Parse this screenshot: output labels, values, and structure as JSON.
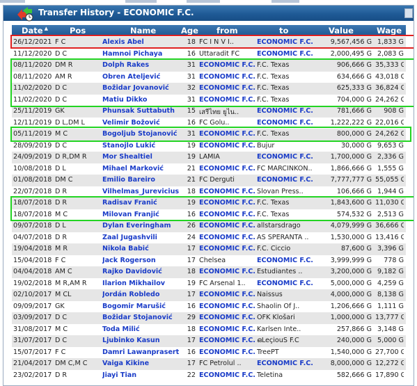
{
  "window": {
    "title": "Transfer History - ECONOMIC F.C."
  },
  "columns": {
    "date": "Date",
    "pos": "Pos",
    "name": "Name",
    "age": "Age",
    "from": "from",
    "to": "to",
    "value": "Value",
    "wage": "Wage"
  },
  "sort_indicator": "▲",
  "colors": {
    "titlebar": "#1f5a96",
    "link": "#1a3cc8",
    "highlight_red": "#e02020",
    "highlight_green": "#22d422"
  },
  "rows": [
    {
      "date": "26/12/2021",
      "pos": "F C",
      "name": "Alexis Abel",
      "age": "18",
      "from": "FC   I N V I..",
      "to": "ECONOMIC F.C.",
      "value": "9,567,456 G",
      "wage": "1,833 G"
    },
    {
      "date": "11/12/2020",
      "pos": "D C",
      "name": "Hamnoi Pichaya",
      "age": "16",
      "from": "Uttaradit FC",
      "to": "ECONOMIC F.C.",
      "value": "2,000,495 G",
      "wage": "2,083 G"
    },
    {
      "date": "08/11/2020",
      "pos": "DM R",
      "name": "Dolph Rakes",
      "age": "31",
      "from": "ECONOMIC F.C.",
      "to": "F.C. Texas",
      "value": "906,666 G",
      "wage": "35,333 G"
    },
    {
      "date": "08/11/2020",
      "pos": "AM R",
      "name": "Obren Ateljević",
      "age": "31",
      "from": "ECONOMIC F.C.",
      "to": "F.C. Texas",
      "value": "634,666 G",
      "wage": "43,018 G"
    },
    {
      "date": "11/02/2020",
      "pos": "D C",
      "name": "Božidar Jovanović",
      "age": "32",
      "from": "ECONOMIC F.C.",
      "to": "F.C. Texas",
      "value": "625,333 G",
      "wage": "36,824 G"
    },
    {
      "date": "11/02/2020",
      "pos": "D C",
      "name": "Matiu Dikko",
      "age": "31",
      "from": "ECONOMIC F.C.",
      "to": "F.C. Texas",
      "value": "704,000 G",
      "wage": "24,262 G"
    },
    {
      "date": "25/11/2019",
      "pos": "GK",
      "name": "Phunsak Suttabuth",
      "age": "15",
      "from": "เสรีไทย ยูไน..",
      "to": "ECONOMIC F.C.",
      "value": "781,666 G",
      "wage": "908 G"
    },
    {
      "date": "12/11/2019",
      "pos": "D L,DM L",
      "name": "Velimir Božović",
      "age": "16",
      "from": "FC Golu..",
      "to": "ECONOMIC F.C.",
      "value": "1,222,222 G",
      "wage": "22,016 G"
    },
    {
      "date": "05/11/2019",
      "pos": "M C",
      "name": "Bogoljub Stojanović",
      "age": "31",
      "from": "ECONOMIC F.C.",
      "to": "F.C. Texas",
      "value": "800,000 G",
      "wage": "24,262 G"
    },
    {
      "date": "28/09/2019",
      "pos": "D C",
      "name": "Stanojlo Lukić",
      "age": "19",
      "from": "ECONOMIC F.C.",
      "to": "Bujur",
      "value": "30,000 G",
      "wage": "9,653 G"
    },
    {
      "date": "24/09/2019",
      "pos": "D R,DM R",
      "name": "Mor Shealtiel",
      "age": "19",
      "from": "LAMIA",
      "to": "ECONOMIC F.C.",
      "value": "1,700,000 G",
      "wage": "2,336 G"
    },
    {
      "date": "10/08/2018",
      "pos": "D L",
      "name": "Mihael Marković",
      "age": "21",
      "from": "ECONOMIC F.C.",
      "to": "FC MARCINKON..",
      "value": "1,866,666 G",
      "wage": "1,555 G"
    },
    {
      "date": "01/08/2018",
      "pos": "DM C",
      "name": "Emilio Bareiro",
      "age": "21",
      "from": "FC Derguti",
      "to": "ECONOMIC F.C.",
      "value": "7,777,777 G",
      "wage": "55,055 G"
    },
    {
      "date": "22/07/2018",
      "pos": "D R",
      "name": "Vilhelmas_Jurevicius",
      "age": "18",
      "from": "ECONOMIC F.C.",
      "to": "Slovan Press..",
      "value": "106,666 G",
      "wage": "1,944 G"
    },
    {
      "date": "18/07/2018",
      "pos": "D R",
      "name": "Radisav Franić",
      "age": "19",
      "from": "ECONOMIC F.C.",
      "to": "F.C. Texas",
      "value": "1,843,600 G",
      "wage": "11,030 G"
    },
    {
      "date": "18/07/2018",
      "pos": "M C",
      "name": "Milovan Franjić",
      "age": "16",
      "from": "ECONOMIC F.C.",
      "to": "F.C. Texas",
      "value": "574,532 G",
      "wage": "2,513 G"
    },
    {
      "date": "09/07/2018",
      "pos": "D L",
      "name": "Dylan Everingham",
      "age": "26",
      "from": "ECONOMIC F.C.",
      "to": "allstarsdrago",
      "value": "4,079,999 G",
      "wage": "36,666 G"
    },
    {
      "date": "04/07/2018",
      "pos": "D R",
      "name": "Zaal Jugashvili",
      "age": "24",
      "from": "ECONOMIC F.C.",
      "to": "AS SPERANTA ..",
      "value": "1,530,000 G",
      "wage": "13,416 G"
    },
    {
      "date": "19/04/2018",
      "pos": "M R",
      "name": "Nikola Babić",
      "age": "17",
      "from": "ECONOMIC F.C.",
      "to": "F.C. Ciccio",
      "value": "87,600 G",
      "wage": "3,396 G"
    },
    {
      "date": "15/04/2018",
      "pos": "F C",
      "name": "Jack Rogerson",
      "age": "17",
      "from": "Chelsea",
      "to": "ECONOMIC F.C.",
      "value": "3,999,999 G",
      "wage": "778 G"
    },
    {
      "date": "04/04/2018",
      "pos": "AM C",
      "name": "Rajko Davidović",
      "age": "18",
      "from": "ECONOMIC F.C.",
      "to": "Estudiantes ..",
      "value": "3,200,000 G",
      "wage": "9,182 G"
    },
    {
      "date": "19/02/2018",
      "pos": "M R,AM R",
      "name": "Ilarion Mikhailov",
      "age": "19",
      "from": "FC Arsenal 1..",
      "to": "ECONOMIC F.C.",
      "value": "5,000,000 G",
      "wage": "4,259 G"
    },
    {
      "date": "02/10/2017",
      "pos": "M CL",
      "name": "Jordán Robledo",
      "age": "17",
      "from": "ECONOMIC F.C.",
      "to": "Naissus",
      "value": "4,000,000 G",
      "wage": "8,138 G"
    },
    {
      "date": "09/09/2017",
      "pos": "GK",
      "name": "Bogomir Marušić",
      "age": "16",
      "from": "ECONOMIC F.C.",
      "to": "Shaolin Of J..",
      "value": "1,206,666 G",
      "wage": "1,111 G"
    },
    {
      "date": "03/09/2017",
      "pos": "D C",
      "name": "Božidar Stojanović",
      "age": "29",
      "from": "ECONOMIC F.C.",
      "to": "OFK Klošari",
      "value": "1,000,000 G",
      "wage": "13,777 G"
    },
    {
      "date": "31/08/2017",
      "pos": "M C",
      "name": "Toda Milić",
      "age": "18",
      "from": "ECONOMIC F.C.",
      "to": "Karlsen Inte..",
      "value": "257,866 G",
      "wage": "3,148 G"
    },
    {
      "date": "31/07/2017",
      "pos": "D C",
      "name": "Ljubinko Kasun",
      "age": "17",
      "from": "ECONOMIC F.C.",
      "to": "ഒLeçiouŠ F.C",
      "value": "240,000 G",
      "wage": "5,000 G"
    },
    {
      "date": "15/07/2017",
      "pos": "F C",
      "name": "Damri Lawanprasert",
      "age": "16",
      "from": "ECONOMIC F.C.",
      "to": "TreePT",
      "value": "1,540,000 G",
      "wage": "27,700 G"
    },
    {
      "date": "21/04/2017",
      "pos": "DM C,M C",
      "name": "Vaiga Kikine",
      "age": "17",
      "from": "FC Petrolul ..",
      "to": "ECONOMIC F.C.",
      "value": "8,000,000 G",
      "wage": "12,272 G"
    },
    {
      "date": "23/02/2017",
      "pos": "D R",
      "name": "Jiayi Tian",
      "age": "22",
      "from": "ECONOMIC F.C.",
      "to": "Teletina",
      "value": "582,666 G",
      "wage": "17,890 G"
    }
  ]
}
